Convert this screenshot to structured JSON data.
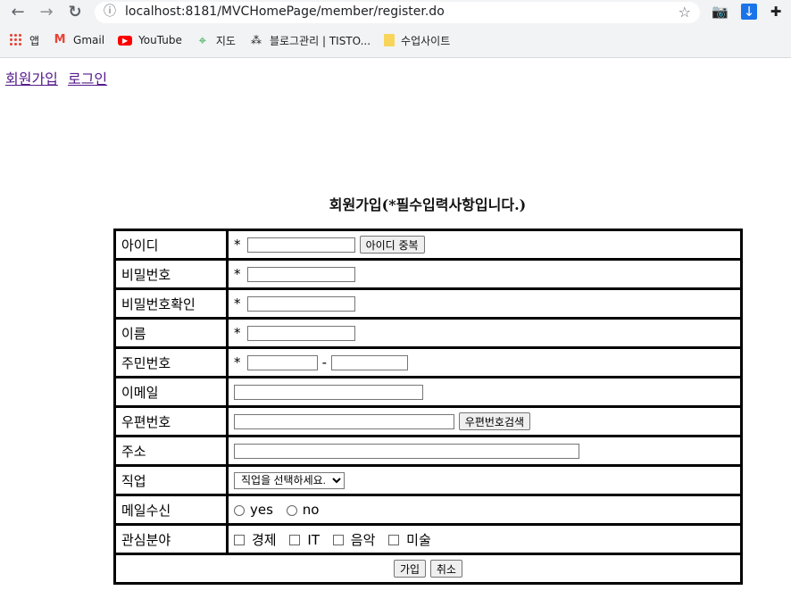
{
  "browser": {
    "url": "localhost:8181/MVCHomePage/member/register.do",
    "bookmarks": [
      {
        "label": "앱",
        "icon": "apps-grid-icon"
      },
      {
        "label": "Gmail",
        "icon": "gmail-icon"
      },
      {
        "label": "YouTube",
        "icon": "youtube-icon"
      },
      {
        "label": "지도",
        "icon": "maps-pin-icon"
      },
      {
        "label": "블로그관리 | TISTO...",
        "icon": "tistory-icon"
      },
      {
        "label": "수업사이트",
        "icon": "folder-icon"
      }
    ]
  },
  "top_links": {
    "join": "회원가입",
    "login": "로그인"
  },
  "form": {
    "title": "회원가입(*필수입력사항입니다.)",
    "required_mark": "*",
    "rows": [
      {
        "label": "아이디"
      },
      {
        "label": "비밀번호"
      },
      {
        "label": "비밀번호확인"
      },
      {
        "label": "이름"
      },
      {
        "label": "주민번호"
      },
      {
        "label": "이메일"
      },
      {
        "label": "우편번호"
      },
      {
        "label": "주소"
      },
      {
        "label": "직업"
      },
      {
        "label": "메일수신"
      },
      {
        "label": "관심분야"
      }
    ],
    "id_check_button": "아이디 중복",
    "resident_separator": "-",
    "postcode_search_button": "우편번호검색",
    "job_select_value": "직업을 선택하세요.",
    "mail_options": [
      "yes",
      "no"
    ],
    "interests": [
      "경제",
      "IT",
      "음악",
      "미술"
    ],
    "submit_button": "가입",
    "cancel_button": "취소"
  }
}
